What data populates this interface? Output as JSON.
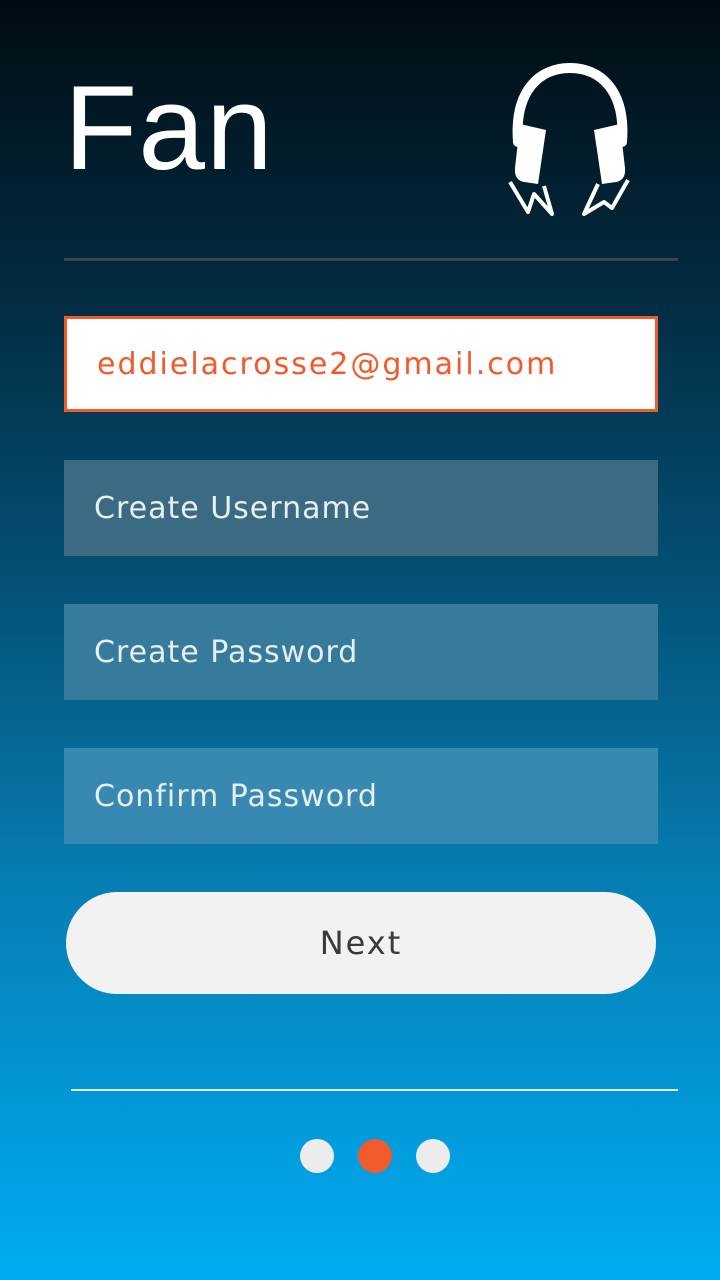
{
  "header": {
    "title": "Fan",
    "logo_icon": "headphones-lightning-icon"
  },
  "form": {
    "email_value": "eddielacrosse2@gmail.com",
    "username_placeholder": "Create Username",
    "password_placeholder": "Create Password",
    "confirm_placeholder": "Confirm Password",
    "next_label": "Next"
  },
  "pagination": {
    "total_steps": 3,
    "current_step": 2
  },
  "colors": {
    "accent": "#f15a2b",
    "field_bg": "#ffffff",
    "button_bg": "#f2f2f2"
  }
}
